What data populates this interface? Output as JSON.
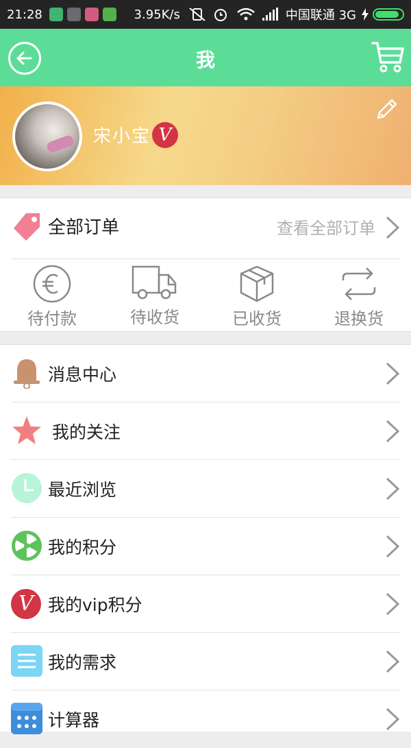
{
  "status_bar": {
    "time": "21:28",
    "network_speed": "3.95K/s",
    "carrier": "中国联通 3G"
  },
  "header": {
    "title": "我"
  },
  "profile": {
    "username": "宋小宝",
    "vip_badge": "V"
  },
  "orders": {
    "label": "全部订单",
    "view_all": "查看全部订单",
    "statuses": [
      {
        "label": "待付款",
        "icon": "euro-coin-icon"
      },
      {
        "label": "待收货",
        "icon": "delivery-truck-icon"
      },
      {
        "label": "已收货",
        "icon": "package-box-icon"
      },
      {
        "label": "退换货",
        "icon": "exchange-arrows-icon"
      }
    ]
  },
  "menu": [
    {
      "label": "消息中心",
      "icon": "bell-icon"
    },
    {
      "label": "我的关注",
      "icon": "star-icon"
    },
    {
      "label": "最近浏览",
      "icon": "clock-icon"
    },
    {
      "label": "我的积分",
      "icon": "points-icon"
    },
    {
      "label": "我的vip积分",
      "icon": "vip-icon",
      "badge": "V"
    },
    {
      "label": "我的需求",
      "icon": "list-icon"
    },
    {
      "label": "计算器",
      "icon": "calculator-icon"
    }
  ],
  "colors": {
    "header_bg": "#5bdd98",
    "vip_red": "#d23544",
    "tag_pink": "#f27f93",
    "bell_brown": "#c8926f",
    "star_pink": "#f08080",
    "clock_mint": "#b8f4d8",
    "points_green": "#5ec35a",
    "list_blue": "#7ad6f4",
    "calc_blue": "#3c8edc"
  }
}
